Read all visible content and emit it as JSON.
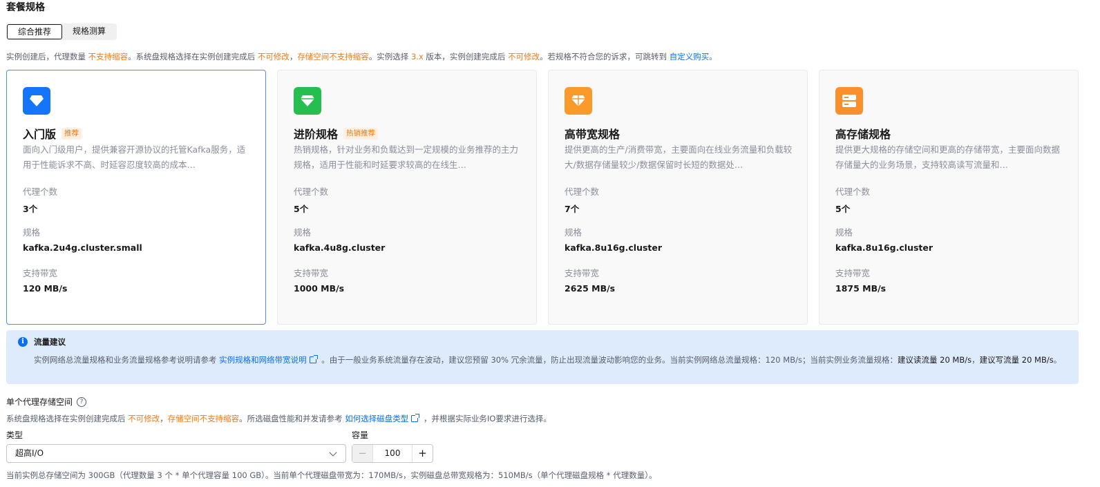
{
  "section_title": "套餐规格",
  "tabs": [
    {
      "label": "综合推荐",
      "active": true
    },
    {
      "label": "规格测算",
      "active": false
    }
  ],
  "notice": {
    "p1": "实例创建后，代理数量 ",
    "o1": "不支持缩容",
    "p2": "。系统盘规格选择在实例创建完成后 ",
    "o2": "不可修改",
    "p3": "，",
    "o3": "存储空间不支持缩容",
    "p4": "。实例选择 ",
    "o4": "3.x",
    "p5": " 版本，实例创建完成后 ",
    "o5": "不可修改",
    "p6": "。若规格不符合您的诉求，可跳转到 ",
    "link": "自定义购买",
    "p7": "。"
  },
  "card_labels": {
    "brokers": "代理个数",
    "spec": "规格",
    "bandwidth": "支持带宽"
  },
  "cards": [
    {
      "name": "入门版",
      "badge": "推荐",
      "selected": true,
      "icon": "diamond-icon",
      "icon_color": "#1474fa",
      "desc": "面向入门级用户，提供兼容开源协议的托管Kafka服务，适用于性能诉求不高、时延容忍度较高的成本…",
      "brokers": "3个",
      "spec": "kafka.2u4g.cluster.small",
      "bandwidth": "120 MB/s"
    },
    {
      "name": "进阶规格",
      "badge": "热销推荐",
      "selected": false,
      "icon": "gem-icon",
      "icon_color": "#26bf4f",
      "desc": "热销规格，针对业务和负载达到一定规模的业务推荐的主力规格，适用于性能和时延要求较高的在线生…",
      "brokers": "5个",
      "spec": "kafka.4u8g.cluster",
      "bandwidth": "1000 MB/s"
    },
    {
      "name": "高带宽规格",
      "badge": "",
      "selected": false,
      "icon": "crystal-icon",
      "icon_color": "#fa9a2b",
      "desc": "提供更高的生产/消费带宽，主要面向在线业务流量和负载较大/数据存储量较少/数据保留时长短的数据处…",
      "brokers": "7个",
      "spec": "kafka.8u16g.cluster",
      "bandwidth": "2625 MB/s"
    },
    {
      "name": "高存储规格",
      "badge": "",
      "selected": false,
      "icon": "storage-icon",
      "icon_color": "#fa8f2b",
      "desc": "提供更大规格的存储空间和更高的存储带宽，主要面向数据存储量大的业务场景，支持较高读写流量和…",
      "brokers": "5个",
      "spec": "kafka.8u16g.cluster",
      "bandwidth": "1875 MB/s"
    }
  ],
  "tip": {
    "title": "流量建议",
    "p1": "实例网络总流量规格和业务流量规格参考说明请参考 ",
    "link": "实例规格和网络带宽说明",
    "p2": " 。由于一般业务系统流量存在波动，建议您预留 30% 冗余流量，防止出现流量波动影响您的业务。当前实例网络总流量规格：120 MB/s；当前实例业务流量规格：",
    "read": "建议读流量 20 MB/s",
    "p3": "，",
    "write": "建议写流量 20 MB/s",
    "p4": "。"
  },
  "storage": {
    "label": "单个代理存储空间",
    "help": "?",
    "note_p1": "系统盘规格选择在实例创建完成后 ",
    "note_o1": "不可修改",
    "note_p2": "，",
    "note_o2": "存储空间不支持缩容",
    "note_p3": "。所选磁盘性能和并发请参考 ",
    "note_link": "如何选择磁盘类型",
    "note_p4": " ，并根据实际业务IO要求进行选择。",
    "type_label": "类型",
    "type_value": "超高I/O",
    "capacity_label": "容量",
    "capacity_value": "100",
    "minus": "−",
    "plus": "+",
    "footer": "当前实例总存储空间为 300GB（代理数量 3 个 * 单个代理容量 100 GB）。当前单个代理磁盘带宽为：170MB/s，实例磁盘总带宽规格为：510MB/s（单个代理磁盘规格 * 代理数量）。"
  }
}
